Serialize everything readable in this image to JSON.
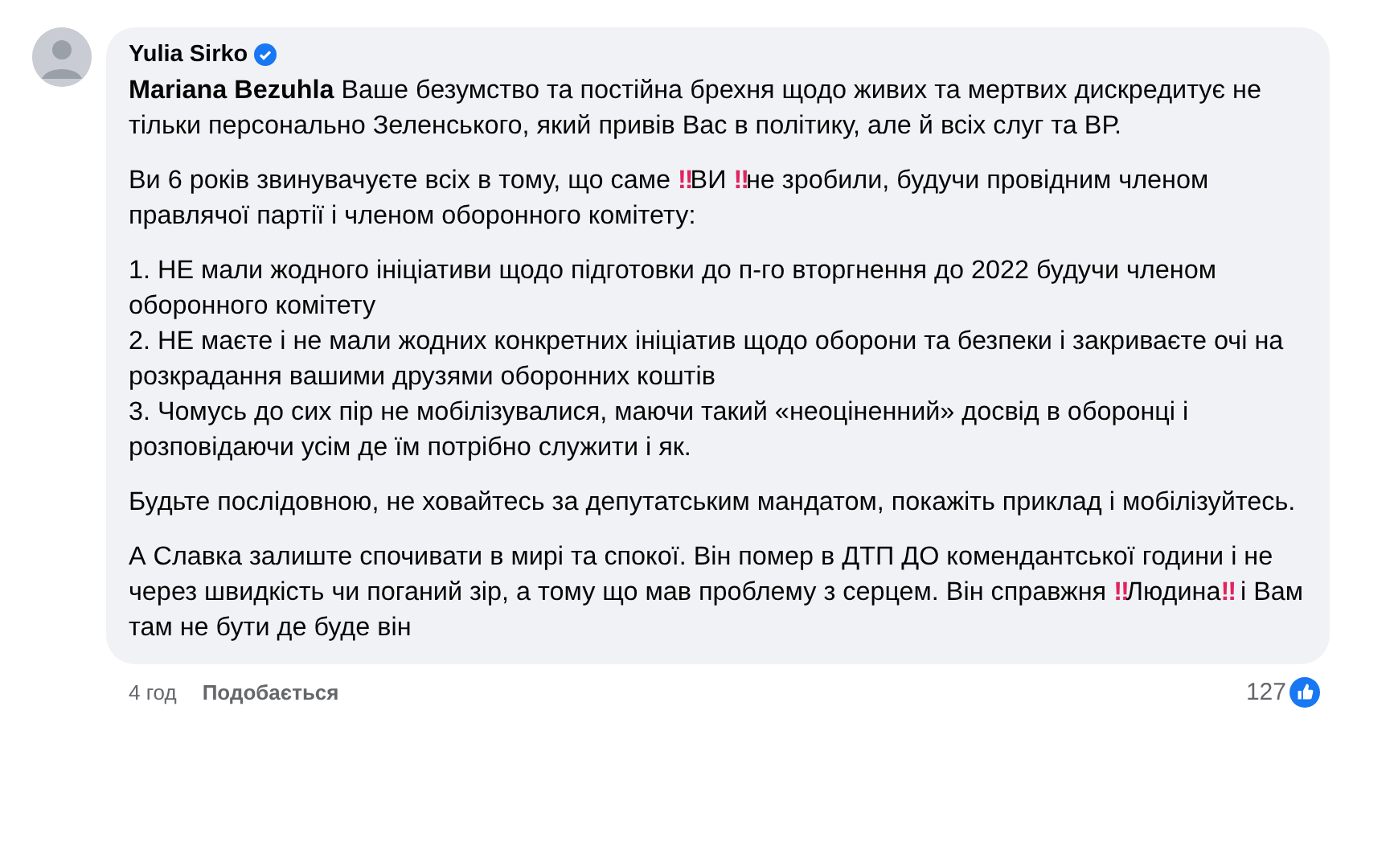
{
  "comment": {
    "author": "Yulia Sirko",
    "verified": true,
    "mention": "Mariana Bezuhla",
    "paragraphs": [
      "Ваше безумство та постійна брехня щодо живих та мертвих дискредитує не тільки персонально Зеленського, який привів Вас в політику, але й всіх слуг та ВР.",
      "Ви 6 років звинувачуєте всіх в тому, що саме ‼️ВИ ‼️не зробили, будучи провідним членом правлячої партії і членом оборонного комітету:",
      "1. НЕ мали жодного ініціативи щодо підготовки до п-го вторгнення до 2022 будучи членом оборонного комітету\n2. НЕ маєте і не мали жодних конкретних ініціатив щодо оборони та безпеки і закриваєте очі на розкрадання вашими друзями оборонних коштів\n3. Чомусь до сих пір не мобілізувалися, маючи такий «неоціненний» досвід в оборонці і розповідаючи усім де їм потрібно служити і як.",
      "Будьте послідовною, не ховайтесь за депутатським мандатом, покажіть приклад і мобілізуйтесь.",
      "А Славка залиште спочивати в мирі та спокої. Він помер в ДТП ДО комендантської години і не через швидкість чи поганий зір, а тому що мав проблему з серцем. Він справжня ‼️Людина‼️ і Вам там не бути де буде він"
    ],
    "time": "4 год",
    "like_action": "Подобається",
    "reaction_count": "127"
  }
}
